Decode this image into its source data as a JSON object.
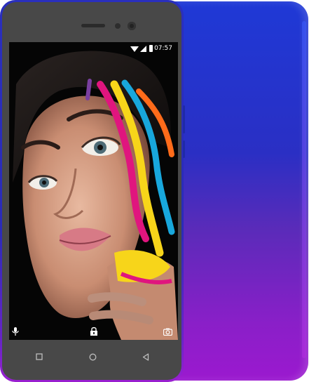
{
  "device": {
    "body_gradient": [
      "#1f39d6",
      "#9b19cf"
    ],
    "bezel_color": "#484848"
  },
  "status_bar": {
    "time": "07:57",
    "icons": [
      "wifi-icon",
      "signal-icon",
      "battery-icon"
    ]
  },
  "lockscreen": {
    "wallpaper": "woman-face-paint-art",
    "bottom_icons": [
      "microphone-icon",
      "lock-icon",
      "camera-icon"
    ]
  },
  "navigation_bar": {
    "buttons": [
      "recents-button",
      "home-button",
      "back-button"
    ]
  }
}
